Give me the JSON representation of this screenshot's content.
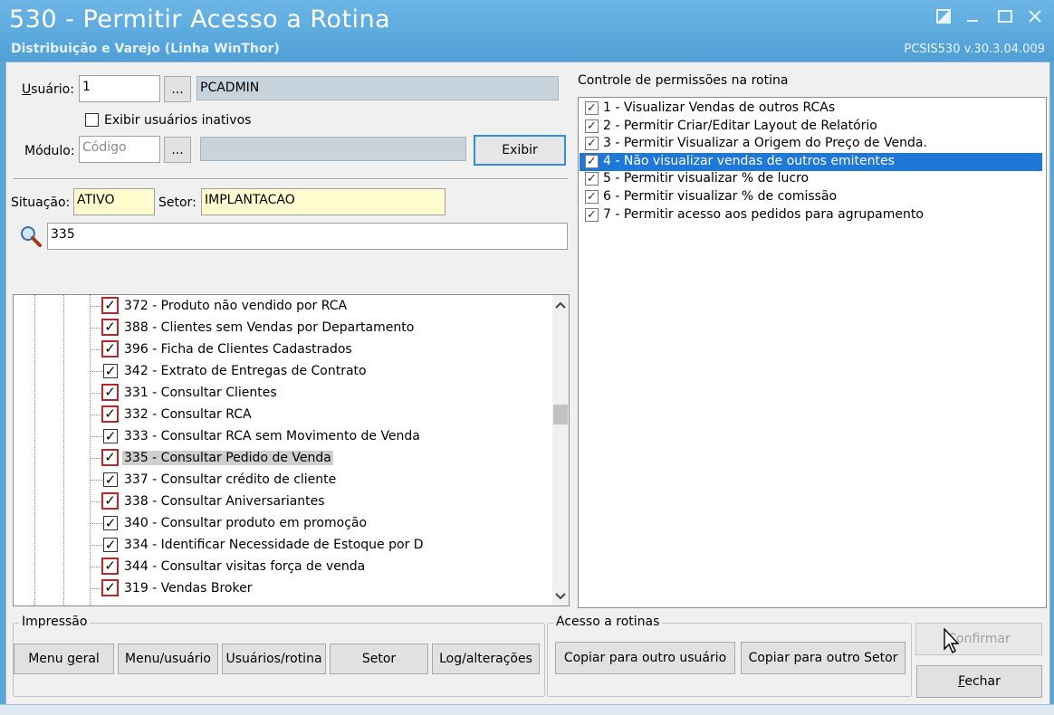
{
  "window": {
    "title": "530 - Permitir Acesso a Rotina",
    "subtitle": "Distribuição e Varejo (Linha WinThor)",
    "version": "PCSIS530  v.30.3.04.009"
  },
  "form": {
    "usuario_label": "Usuário:",
    "usuario_code": "1",
    "usuario_lookup": "...",
    "usuario_name": "PCADMIN",
    "inactive_label": "Exibir usuários inativos",
    "modulo_label": "Módulo:",
    "modulo_placeholder": "Código",
    "modulo_lookup": "...",
    "exibir_button": "Exibir",
    "situacao_label": "Situação:",
    "situacao_value": "ATIVO",
    "setor_label": "Setor:",
    "setor_value": "IMPLANTACAO",
    "search_value": "335"
  },
  "tree": {
    "items": [
      {
        "label": "372 - Produto não vendido por RCA",
        "style": "red"
      },
      {
        "label": "388 - Clientes sem Vendas por Departamento",
        "style": "red"
      },
      {
        "label": "396 - Ficha de Clientes Cadastrados",
        "style": "red"
      },
      {
        "label": "342 - Extrato de Entregas de Contrato",
        "style": "black"
      },
      {
        "label": "331 - Consultar Clientes",
        "style": "red"
      },
      {
        "label": "332 - Consultar RCA",
        "style": "red"
      },
      {
        "label": "333 - Consultar RCA sem Movimento de Venda",
        "style": "black"
      },
      {
        "label": "335 - Consultar Pedido de Venda",
        "style": "red",
        "selected": true
      },
      {
        "label": "337 - Consultar crédito de cliente",
        "style": "black"
      },
      {
        "label": "338 - Consultar Aniversariantes",
        "style": "red"
      },
      {
        "label": "340 - Consultar produto em promoção",
        "style": "black"
      },
      {
        "label": "334 - Identificar Necessidade de Estoque por D",
        "style": "black"
      },
      {
        "label": "344 - Consultar visitas força de venda",
        "style": "red"
      },
      {
        "label": "319 - Vendas Broker",
        "style": "red"
      }
    ]
  },
  "permissions": {
    "title": "Controle de permissões na rotina",
    "items": [
      {
        "label": "1 - Visualizar Vendas de outros RCAs",
        "checked": true
      },
      {
        "label": "2 - Permitir Criar/Editar Layout de Relatório",
        "checked": true
      },
      {
        "label": "3 - Permitir Visualizar a Origem do Preço de Venda.",
        "checked": true
      },
      {
        "label": "4 - Não visualizar vendas de outros emitentes",
        "checked": true,
        "selected": true
      },
      {
        "label": "5 - Permitir visualizar % de lucro",
        "checked": true
      },
      {
        "label": "6 - Permitir visualizar % de comissão",
        "checked": true
      },
      {
        "label": "7 - Permitir acesso aos pedidos para agrupamento",
        "checked": true
      }
    ]
  },
  "impressao": {
    "title": "Impressão",
    "buttons": [
      "Menu geral",
      "Menu/usuário",
      "Usuários/rotina",
      "Setor",
      "Log/alterações"
    ]
  },
  "acesso": {
    "title": "Acesso a rotinas",
    "copy_user": "Copiar para outro usuário",
    "copy_setor": "Copiar para outro Setor"
  },
  "actions": {
    "confirmar": "Confirmar",
    "fechar": "Fechar"
  },
  "colors": {
    "titlebar": "#5aa6d8",
    "selection": "#1e78d7",
    "red_check_border": "#b7282e"
  }
}
